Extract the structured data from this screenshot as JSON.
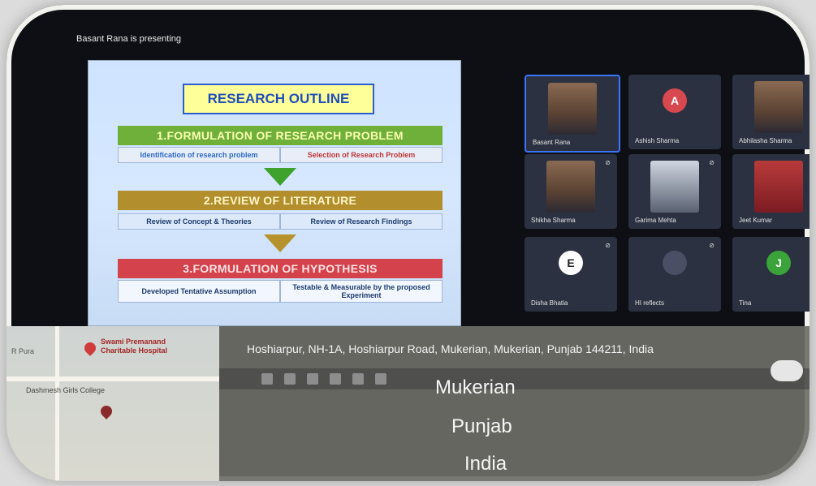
{
  "meeting": {
    "presenting_text": "Basant Rana is presenting"
  },
  "slide": {
    "title": "RESEARCH OUTLINE",
    "step1": "1.FORMULATION OF RESEARCH PROBLEM",
    "step1_left": "Identification of research problem",
    "step1_right": "Selection of Research Problem",
    "step2": "2.REVIEW OF LITERATURE",
    "step2_left": "Review of Concept & Theories",
    "step2_right": "Review of Research Findings",
    "step3": "3.FORMULATION OF HYPOTHESIS",
    "step3_left": "Developed Tentative Assumption",
    "step3_right": "Testable & Measurable by the proposed Experiment"
  },
  "participants": [
    {
      "name": "Basant Rana",
      "type": "video",
      "active": true
    },
    {
      "name": "Ashish Sharma",
      "type": "avatar",
      "initial": "A",
      "color": "#d8484f"
    },
    {
      "name": "Abhilasha Sharma",
      "type": "video"
    },
    {
      "name": "Shikha Sharma",
      "type": "video"
    },
    {
      "name": "Garima Mehta",
      "type": "video"
    },
    {
      "name": "Jeet Kumar",
      "type": "video"
    },
    {
      "name": "Disha Bhatia",
      "type": "avatar",
      "initial": "E",
      "color": "#ffffff"
    },
    {
      "name": "HI reflects",
      "type": "avatar",
      "initial": "",
      "color": "#4a4f66"
    },
    {
      "name": "Tina",
      "type": "avatar",
      "initial": "J",
      "color": "#3aa33a"
    }
  ],
  "map": {
    "place1_line1": "Swami Premanand",
    "place1_line2": "Charitable Hospital",
    "place2": "Dashmesh Girls College",
    "left_label": "R Pura"
  },
  "gps": {
    "address": "Hoshiarpur, NH-1A, Hoshiarpur Road, Mukerian, Mukerian, Punjab 144211, India",
    "city": "Mukerian",
    "state": "Punjab",
    "country": "India"
  }
}
